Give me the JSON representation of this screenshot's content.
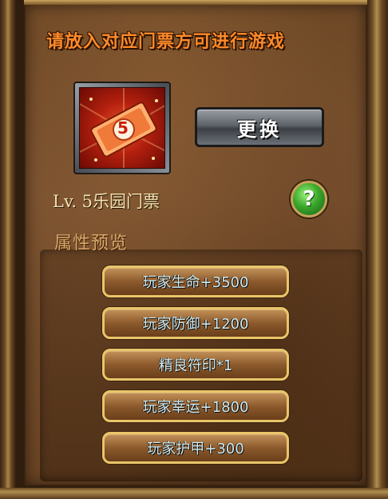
{
  "notice": "请放入对应门票方可进行游戏",
  "ticket": {
    "icon": "ticket-icon",
    "badge": "5",
    "name": "Lv. 5乐园门票"
  },
  "swap_button_label": "更换",
  "help_button_label": "?",
  "preview": {
    "title": "属性预览",
    "attributes": [
      "玩家生命+3500",
      "玩家防御+1200",
      "精良符印*1",
      "玩家幸运+1800",
      "玩家护甲+300"
    ]
  },
  "colors": {
    "notice": "#ff8a2a",
    "attribute_text": "#cfeef6",
    "attribute_border": "#e9c56a",
    "help_green": "#3aa82a"
  }
}
